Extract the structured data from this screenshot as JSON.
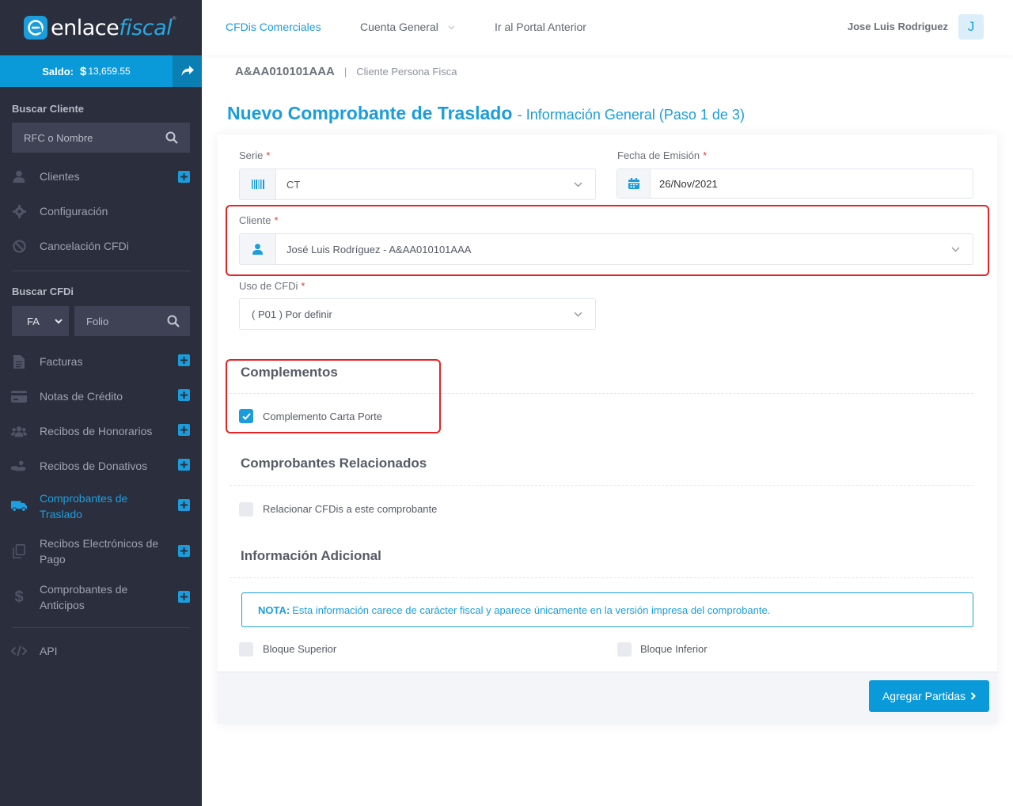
{
  "app": {
    "logo_main": "enlace",
    "logo_accent": "fiscal",
    "logo_mark": "e"
  },
  "saldo": {
    "label": "Saldo:",
    "currency": "$",
    "value": "13,659.55"
  },
  "sidebar": {
    "buscar_cliente": {
      "title": "Buscar Cliente",
      "placeholder": "RFC o Nombre"
    },
    "client_items": [
      {
        "label": "Clientes",
        "icon": "user-icon",
        "has_plus": true
      },
      {
        "label": "Configuración",
        "icon": "gear-icon",
        "has_plus": false
      },
      {
        "label": "Cancelación CFDi",
        "icon": "ban-icon",
        "has_plus": false
      }
    ],
    "buscar_cfdi": {
      "title": "Buscar CFDi",
      "type_value": "FA",
      "folio_placeholder": "Folio"
    },
    "cfdi_items": [
      {
        "label": "Facturas",
        "icon": "file-icon"
      },
      {
        "label": "Notas de Crédito",
        "icon": "credit-card-icon"
      },
      {
        "label": "Recibos de Honorarios",
        "icon": "users-icon"
      },
      {
        "label": "Recibos de Donativos",
        "icon": "donation-icon"
      },
      {
        "label": "Comprobantes de Traslado",
        "icon": "truck-icon",
        "active": true
      },
      {
        "label": "Recibos Electrónicos de Pago",
        "icon": "copy-icon"
      },
      {
        "label": "Comprobantes de Anticipos",
        "icon": "dollar-icon"
      }
    ],
    "api_label": "API"
  },
  "topnav": {
    "links": [
      "CFDis Comerciales",
      "Cuenta General",
      "Ir al Portal Anterior"
    ],
    "active_index": 0,
    "user_name": "Jose Luis Rodriguez",
    "avatar_initial": "J"
  },
  "breadcrumb": {
    "rfc": "A&AA010101AAA",
    "separator": "|",
    "subtitle": "Cliente Persona Fisca"
  },
  "page": {
    "title": "Nuevo Comprobante de Traslado",
    "subtitle": "- Información General (Paso 1 de 3)"
  },
  "form": {
    "serie": {
      "label": "Serie",
      "value": "CT"
    },
    "fecha": {
      "label": "Fecha de Emisión",
      "value": "26/Nov/2021"
    },
    "cliente": {
      "label": "Cliente",
      "value": "José Luis Rodríguez - A&AA010101AAA"
    },
    "uso_cfdi": {
      "label": "Uso de CFDi",
      "value": "( P01 ) Por definir"
    },
    "required_mark": "*"
  },
  "sections": {
    "complementos": {
      "title": "Complementos",
      "checkbox_label": "Complemento Carta Porte",
      "checked": true
    },
    "relacionados": {
      "title": "Comprobantes Relacionados",
      "checkbox_label": "Relacionar CFDis a este comprobante",
      "checked": false
    },
    "adicional": {
      "title": "Información Adicional",
      "note_label": "NOTA:",
      "note_text": "Esta información carece de carácter fiscal y aparece únicamente en la versión impresa del comprobante.",
      "bloque_superior": "Bloque Superior",
      "bloque_inferior": "Bloque Inferior"
    }
  },
  "actions": {
    "next_label": "Agregar Partidas"
  },
  "colors": {
    "accent": "#1b9ddc",
    "sidebar": "#2b2e3c",
    "highlight": "#e52326"
  }
}
